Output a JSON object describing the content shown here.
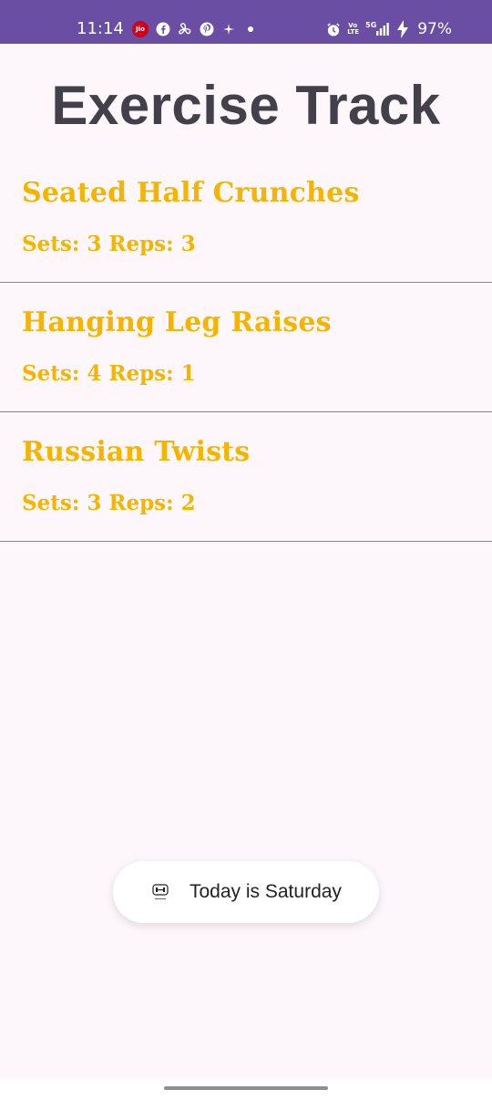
{
  "status_bar": {
    "time": "11:14",
    "carrier_badge": "Jio",
    "left_icons": [
      "jio-icon",
      "facebook-icon",
      "fan-icon",
      "pinterest-icon",
      "sparkle-icon",
      "dot-icon"
    ],
    "right_icons": [
      "alarm-icon",
      "volte-icon",
      "5g-signal-icon",
      "charging-icon"
    ],
    "volte_label": "Vo LTE",
    "network_label": "5G",
    "battery": "97%",
    "background_color": "#6a4ea3"
  },
  "app": {
    "title": "Exercise Track",
    "accent_color": "#f5b400"
  },
  "exercises": [
    {
      "name": "Seated Half Crunches",
      "stats": "Sets: 3 Reps: 3"
    },
    {
      "name": "Hanging Leg Raises",
      "stats": "Sets: 4 Reps: 1"
    },
    {
      "name": "Russian Twists",
      "stats": "Sets: 3 Reps: 2"
    }
  ],
  "toast": {
    "icon": "dumbbell-app-icon",
    "message": "Today is Saturday"
  }
}
